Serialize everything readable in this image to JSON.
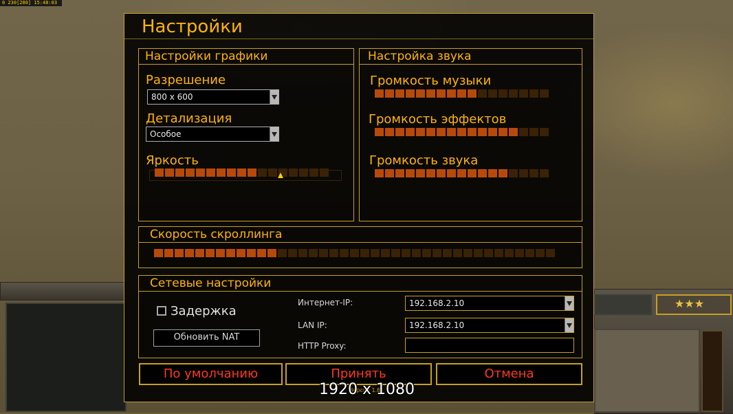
{
  "hud": {
    "status": "0 230[280] 15:48:03",
    "rank_stars": "★★★"
  },
  "dialog": {
    "title": "Настройки"
  },
  "graphics": {
    "title": "Настройки графики",
    "resolution_label": "Разрешение",
    "resolution_value": "800 x 600",
    "detail_label": "Детализация",
    "detail_value": "Особое",
    "brightness_label": "Яркость",
    "brightness_level": 0.57
  },
  "sound": {
    "title": "Настройка звука",
    "music_label": "Громкость музыки",
    "music_level": 0.6,
    "effects_label": "Громкость эффектов",
    "effects_level": 0.85,
    "voice_label": "Громкость звука",
    "voice_level": 0.75
  },
  "scroll": {
    "title": "Скорость скроллинга",
    "level": 0.3
  },
  "network": {
    "title": "Сетевые настройки",
    "lag_label": "Задержка",
    "lag_checked": false,
    "nat_button": "Обновить NAT",
    "internet_ip_label": "Интернет-IP:",
    "internet_ip_value": "192.168.2.10",
    "lan_ip_label": "LAN IP:",
    "lan_ip_value": "192.168.2.10",
    "proxy_label": "HTTP Proxy:",
    "proxy_value": ""
  },
  "buttons": {
    "defaults": "По умолчанию",
    "accept": "Принять",
    "cancel": "Отмена"
  },
  "overlay": {
    "resolution_text": "1920 x 1080",
    "version_text": "Версия 1.8"
  },
  "colors": {
    "gold": "#ffb400",
    "border": "#c8a020",
    "slider_on": "#b74a0a",
    "slider_off": "#3a2206",
    "button_text": "#ff3a18"
  }
}
